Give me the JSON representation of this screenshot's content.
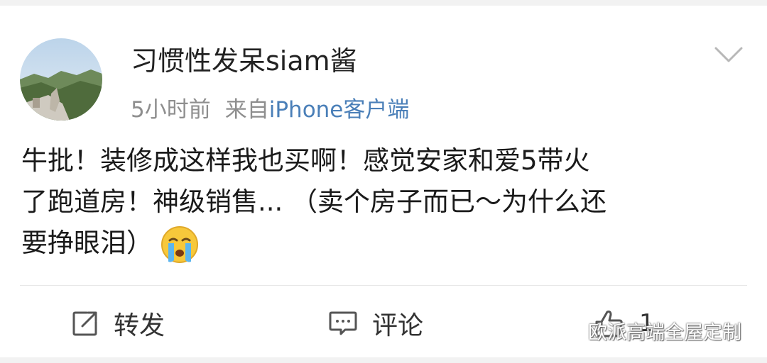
{
  "post": {
    "username": "习惯性发呆siam酱",
    "time": "5小时前",
    "source_prefix": "来自",
    "source_client": "iPhone客户端",
    "text_lines": [
      "牛批！装修成这样我也买啊！感觉安家和爱5带火",
      "了跑道房！神级销售... （卖个房子而已～为什么还",
      "要挣眼泪）"
    ],
    "emoji": "crying-face"
  },
  "actions": {
    "repost_label": "转发",
    "comment_label": "评论",
    "like_count": "1"
  },
  "watermark": {
    "text": "欧派高端全屋定制"
  },
  "colors": {
    "background": "#f2f2f2",
    "card": "#ffffff",
    "link": "#4a7fb8",
    "meta": "#8e8e8e",
    "text": "#1a1a1a"
  }
}
